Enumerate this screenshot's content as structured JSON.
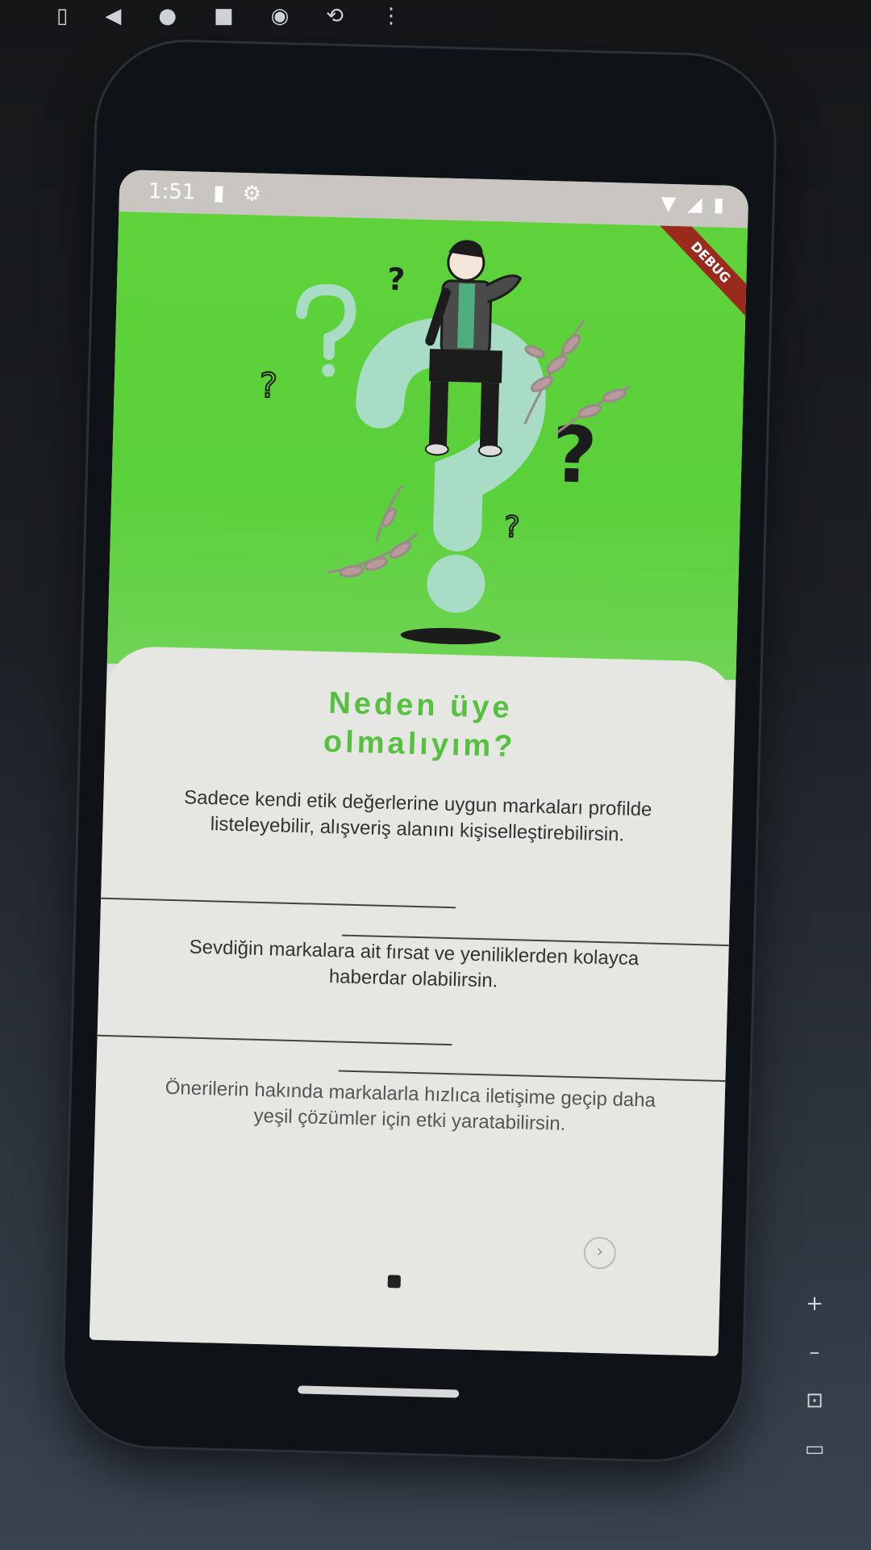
{
  "status_bar": {
    "time": "1:51"
  },
  "debug_badge": "DEBUG",
  "card": {
    "title_line1": "Neden üye",
    "title_line2": "olmalıyım?",
    "paragraph1": "Sadece kendi etik değerlerine uygun markaları profilde listeleyebilir, alışveriş alanını kişiselleştirebilirsin.",
    "paragraph2": "Sevdiğin markalara ait fırsat ve yeniliklerden kolayca haberdar olabilirsin.",
    "paragraph3": "Önerilerin hakında markalarla hızlıca iletişime geçip daha yeşil çözümler için etki yaratabilirsin."
  },
  "colors": {
    "hero_green": "#5fd23b",
    "title_green": "#56c140",
    "card_bg": "#e6e6e2"
  }
}
